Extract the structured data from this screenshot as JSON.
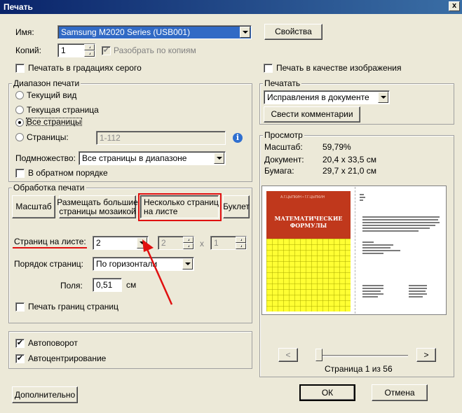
{
  "title": "Печать",
  "close_glyph": "x",
  "printer": {
    "name_label": "Имя:",
    "name_value": "Samsung M2020 Series (USB001)",
    "properties_btn": "Свойства",
    "copies_label": "Копий:",
    "copies_value": "1",
    "collate_label": "Разобрать по копиям",
    "collate_checked": true,
    "grayscale_label": "Печатать в градациях серого",
    "as_image_label": "Печать в качестве изображения"
  },
  "range": {
    "title": "Диапазон печати",
    "current_view": "Текущий вид",
    "current_page": "Текущая страница",
    "all_pages": "Все страницы",
    "pages_label": "Страницы:",
    "pages_placeholder": "1-112",
    "subset_label": "Подмножество:",
    "subset_value": "Все страницы в диапазоне",
    "reverse_label": "В обратном порядке"
  },
  "print_what": {
    "title": "Печатать",
    "value": "Исправления в документе",
    "summarize_btn": "Свести комментарии"
  },
  "handling": {
    "title": "Обработка печати",
    "tabs": [
      "Масштаб",
      "Размещать большие страницы мозаикой",
      "Несколько страниц на листе",
      "Буклет"
    ],
    "tab_lines": [
      [
        "Масштаб"
      ],
      [
        "Размещать большие",
        "страницы мозаикой"
      ],
      [
        "Несколько страниц",
        "на листе"
      ],
      [
        "Буклет"
      ]
    ],
    "per_sheet_label": "Страниц на листе:",
    "per_sheet_value": "2",
    "cols_value": "2",
    "x_sep": "x",
    "rows_value": "1",
    "order_label": "Порядок страниц:",
    "order_value": "По горизонтали",
    "margin_label": "Поля:",
    "margin_value": "0,51",
    "margin_unit": "см",
    "borders_label": "Печать границ страниц"
  },
  "options": {
    "autorotate_label": "Автоповорот",
    "autorotate_checked": true,
    "autocenter_label": "Автоцентрирование",
    "autocenter_checked": true
  },
  "preview": {
    "title": "Просмотр",
    "scale_label": "Масштаб:",
    "scale_value": "59,79%",
    "document_label": "Документ:",
    "document_value": "20,4 x 33,5 см",
    "paper_label": "Бумага:",
    "paper_value": "29,7 x 21,0 см",
    "book_authors": "А.Г.ЦЫПКИН  •  Г.Г.ЦЫПКИН",
    "book_title_1": "МАТЕМАТИЧЕСКИЕ",
    "book_title_2": "ФОРМУЛЫ",
    "prev_btn": "<",
    "next_btn": ">",
    "page_status": "Страница 1 из 56",
    "slider_position": 0.0
  },
  "footer": {
    "advanced_btn": "Дополнительно",
    "ok_btn": "ОК",
    "cancel_btn": "Отмена"
  },
  "accent": {
    "highlight": "#316ac5",
    "annotation": "#e01010",
    "book_cover": "#c0381c",
    "book_grid": "#ffff33"
  }
}
